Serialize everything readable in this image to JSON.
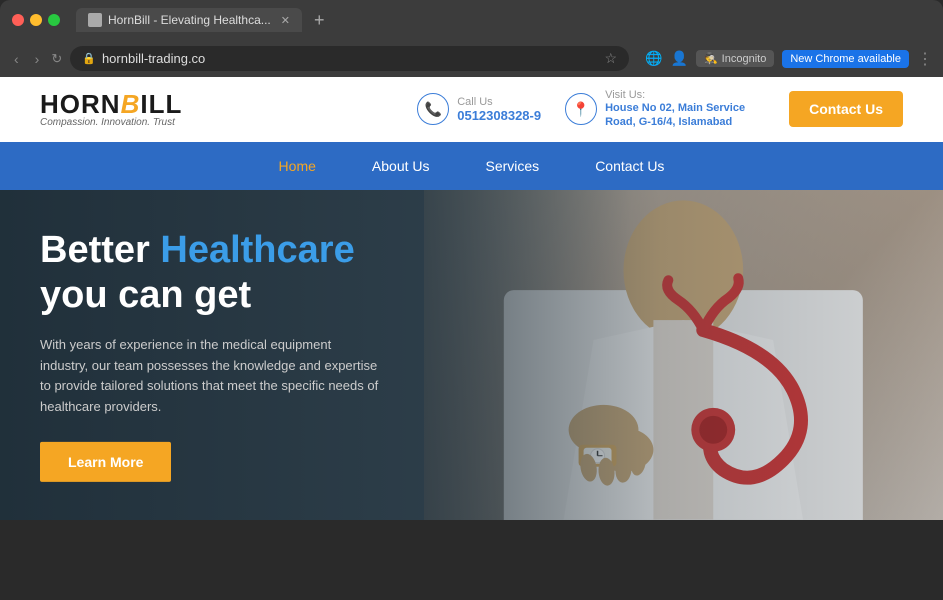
{
  "browser": {
    "traffic_lights": [
      "red",
      "yellow",
      "green"
    ],
    "tab_title": "HornBill - Elevating Healthca...",
    "new_tab_icon": "+",
    "nav_back": "‹",
    "nav_forward": "›",
    "nav_refresh": "↻",
    "url": "hornbill-trading.co",
    "star_icon": "☆",
    "globe_icon": "🌐",
    "incognito_label": "Incognito",
    "new_chrome_label": "New Chrome available",
    "more_icon": "⋮"
  },
  "header": {
    "logo_horn": "HORN",
    "logo_bill": "BILL",
    "tagline": "Compassion. Innovation. Trust",
    "call_label": "Call Us",
    "phone": "0512308328-9",
    "visit_label": "Visit Us:",
    "address": "House No 02, Main Service Road, G-16/4, Islamabad",
    "contact_btn": "Contact Us"
  },
  "nav": {
    "items": [
      {
        "label": "Home",
        "active": true
      },
      {
        "label": "About Us",
        "active": false
      },
      {
        "label": "Services",
        "active": false
      },
      {
        "label": "Contact Us",
        "active": false
      }
    ]
  },
  "hero": {
    "title_part1": "Better ",
    "title_highlight": "Healthcare",
    "title_part2": "you can get",
    "description": "With years of experience in the medical equipment industry, our team possesses the knowledge and expertise to provide tailored solutions that meet the specific needs of healthcare providers.",
    "cta_label": "Learn More"
  }
}
